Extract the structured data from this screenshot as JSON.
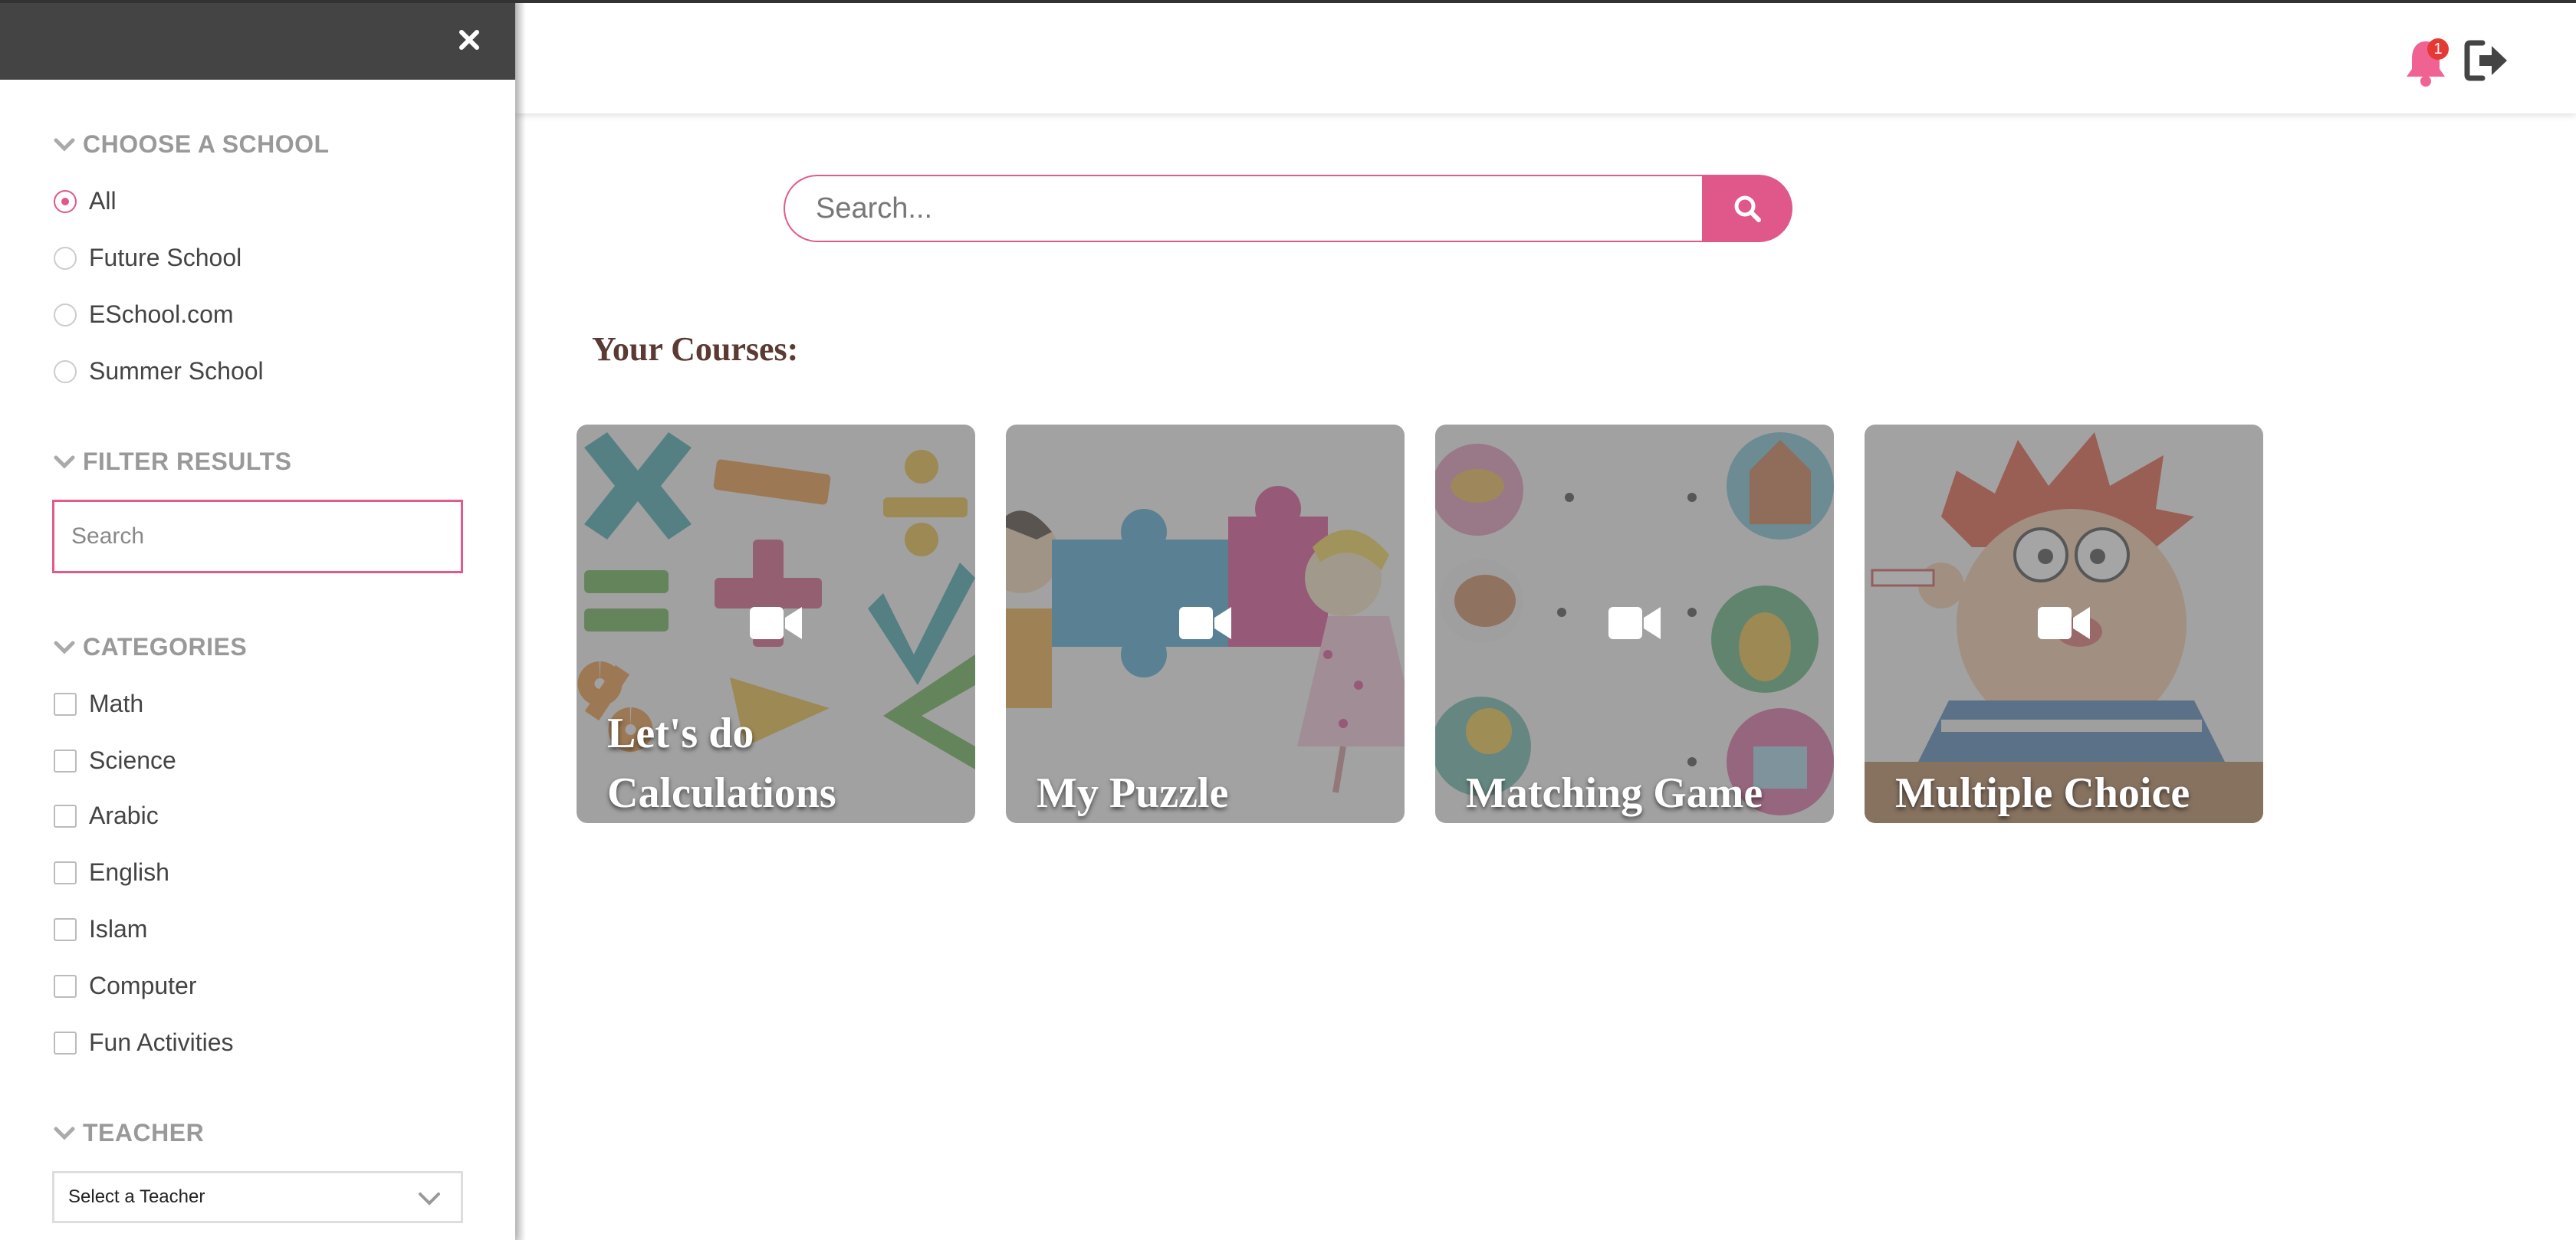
{
  "sidebar": {
    "close_label": "×",
    "school": {
      "heading": "CHOOSE A SCHOOL",
      "options": [
        "All",
        "Future School",
        "ESchool.com",
        "Summer School"
      ],
      "selected": "All"
    },
    "filter": {
      "heading": "FILTER RESULTS",
      "placeholder": "Search",
      "value": ""
    },
    "categories": {
      "heading": "CATEGORIES",
      "items": [
        "Math",
        "Science",
        "Arabic",
        "English",
        "Islam",
        "Computer",
        "Fun Activities"
      ]
    },
    "teacher": {
      "heading": "TEACHER",
      "selected": "Select a Teacher"
    }
  },
  "header": {
    "notification_count": "1",
    "icons": [
      "bell-icon",
      "logout-icon"
    ]
  },
  "search": {
    "placeholder": "Search...",
    "value": ""
  },
  "courses": {
    "title": "Your Courses:",
    "items": [
      {
        "title": "Let's do Calculations",
        "art": "math-symbols"
      },
      {
        "title": "My Puzzle",
        "art": "puzzle-kids"
      },
      {
        "title": "Matching Game",
        "art": "matching-animals"
      },
      {
        "title": "Multiple Choice",
        "art": "cartoon-boy"
      }
    ]
  },
  "colors": {
    "accent": "#e0578a",
    "sidebar_top": "#444444",
    "heading": "#5a3a32"
  }
}
